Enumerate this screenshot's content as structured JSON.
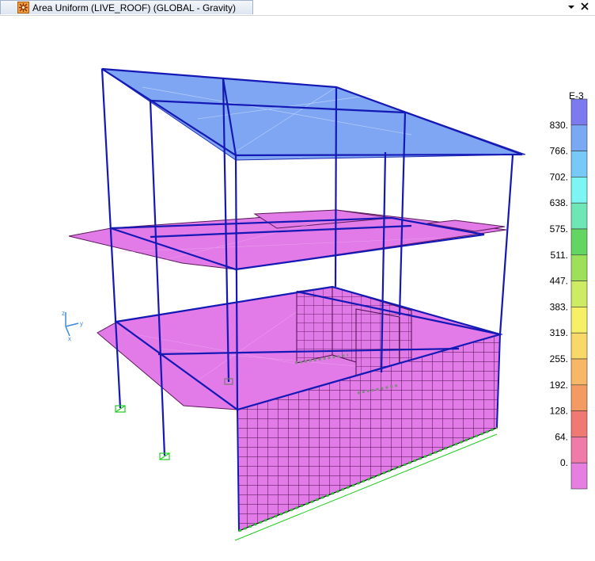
{
  "window": {
    "title": "Area Uniform (LIVE_ROOF) (GLOBAL - Gravity)",
    "dropdown_icon": "chevron-down-icon",
    "close_icon": "close-icon"
  },
  "axis_triad": {
    "x": "x",
    "y": "y",
    "z": "z"
  },
  "legend": {
    "exponent": "E-3",
    "labels": [
      "830.",
      "766.",
      "702.",
      "638.",
      "575.",
      "511.",
      "447.",
      "383.",
      "319.",
      "255.",
      "192.",
      "128.",
      "64.",
      "0."
    ],
    "colors": [
      "#7b7bef",
      "#7aa9f4",
      "#77c9f7",
      "#7ef5f5",
      "#6ee6b5",
      "#63d563",
      "#9fe05b",
      "#cdeb63",
      "#f6ef68",
      "#f7d868",
      "#f6b766",
      "#f49a63",
      "#f07a73",
      "#f07aa8",
      "#e680e0"
    ]
  },
  "colors": {
    "roof": "#7ea6f2",
    "slab": "#e27ae8",
    "frame": "#1418b4",
    "support": "#22dd22"
  }
}
